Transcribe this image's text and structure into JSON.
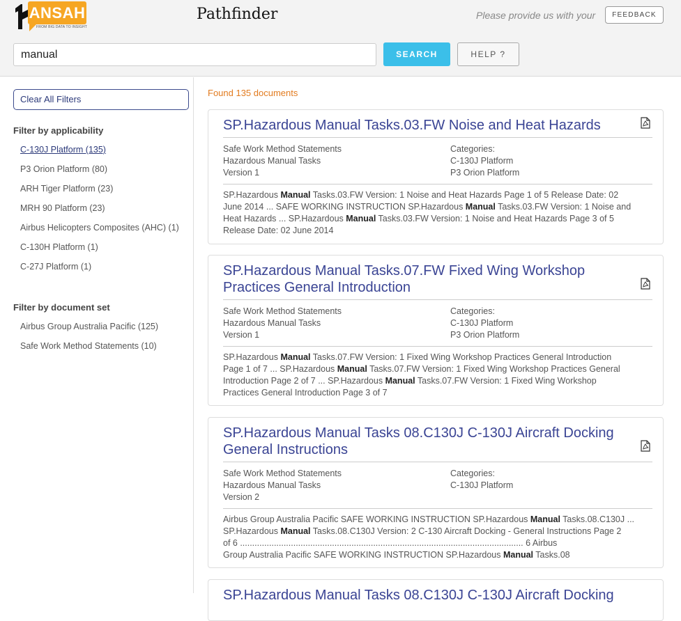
{
  "header": {
    "logo_text": "ANSAH",
    "logo_tagline": "FROM BIG DATA TO INSIGHT",
    "app_title": "Pathfinder",
    "feedback_prompt": "Please provide us with your",
    "feedback_label": "FEEDBACK",
    "search_value": "manual",
    "search_label": "SEARCH",
    "help_label": "HELP ?"
  },
  "sidebar": {
    "clear_label": "Clear All Filters",
    "applicability_heading": "Filter by applicability",
    "applicability_items": [
      "C-130J Platform (135)",
      "P3 Orion Platform (80)",
      "ARH Tiger Platform (23)",
      "MRH 90 Platform (23)",
      "Airbus Helicopters Composites (AHC) (1)",
      "C-130H Platform (1)",
      "C-27J Platform (1)"
    ],
    "docset_heading": "Filter by document set",
    "docset_items": [
      "Airbus Group Australia Pacific (125)",
      "Safe Work Method Statements (10)"
    ]
  },
  "results": {
    "found_text": "Found 135 documents",
    "categories_label": "Categories:",
    "items": [
      {
        "title": "SP.Hazardous Manual Tasks.03.FW Noise and Heat Hazards",
        "meta": [
          "Safe Work Method Statements",
          "Hazardous Manual Tasks",
          "Version 1"
        ],
        "categories": [
          "C-130J Platform",
          "P3 Orion Platform"
        ],
        "snippet": [
          [
            "SP.Hazardous ",
            "Manual",
            " Tasks.03.FW Version: 1 Noise and Heat Hazards Page 1 of 5 Release Date: 02"
          ],
          [
            "June 2014 ... SAFE WORKING INSTRUCTION SP.Hazardous ",
            "Manual",
            " Tasks.03.FW Version: 1 Noise and"
          ],
          [
            "Heat Hazards ... SP.Hazardous ",
            "Manual",
            " Tasks.03.FW Version: 1 Noise and Heat Hazards Page 3 of 5"
          ],
          [
            "Release Date: 02 June 2014",
            "",
            ""
          ]
        ]
      },
      {
        "title": "SP.Hazardous Manual Tasks.07.FW Fixed Wing Workshop Practices General Introduction",
        "meta": [
          "Safe Work Method Statements",
          "Hazardous Manual Tasks",
          "Version 1"
        ],
        "categories": [
          "C-130J Platform",
          "P3 Orion Platform"
        ],
        "snippet": [
          [
            "SP.Hazardous ",
            "Manual",
            " Tasks.07.FW Version: 1 Fixed Wing Workshop Practices General Introduction"
          ],
          [
            "Page 1 of 7 ... SP.Hazardous ",
            "Manual",
            " Tasks.07.FW Version: 1 Fixed Wing Workshop Practices General"
          ],
          [
            "Introduction Page 2 of 7 ... SP.Hazardous ",
            "Manual",
            " Tasks.07.FW Version: 1 Fixed Wing Workshop"
          ],
          [
            "Practices General Introduction Page 3 of 7",
            "",
            ""
          ]
        ]
      },
      {
        "title": "SP.Hazardous Manual Tasks 08.C130J C-130J Aircraft Docking General Instructions",
        "meta": [
          "Safe Work Method Statements",
          "Hazardous Manual Tasks",
          "Version 2"
        ],
        "categories": [
          "C-130J Platform"
        ],
        "snippet": [
          [
            "Airbus Group Australia Pacific SAFE WORKING INSTRUCTION SP.Hazardous ",
            "Manual",
            " Tasks.08.C130J ..."
          ],
          [
            "SP.Hazardous ",
            "Manual",
            " Tasks.08.C130J Version: 2 C-130 Aircraft Docking - General Instructions Page 2"
          ],
          [
            "of 6 ..................................................................................................................... 6  Airbus",
            "",
            ""
          ],
          [
            "Group Australia Pacific SAFE WORKING INSTRUCTION SP.Hazardous ",
            "Manual",
            " Tasks.08"
          ]
        ]
      },
      {
        "title": "SP.Hazardous Manual Tasks 08.C130J C-130J Aircraft Docking"
      }
    ]
  }
}
